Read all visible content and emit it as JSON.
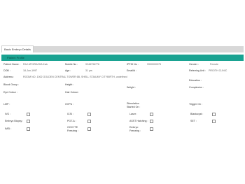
{
  "tab": {
    "label": "Basic Embryo Details"
  },
  "section": {
    "title": "Patient Profile"
  },
  "fields": {
    "patient_name": {
      "label": "Patient Name :",
      "value": "RAJ ATHIRAZHA Ihsk"
    },
    "mobile_no": {
      "label": "Mobile No :",
      "value": "9248736776"
    },
    "ipfid_no": {
      "label": "IPFID No :",
      "value": "9900000075"
    },
    "gender": {
      "label": "Gender :",
      "value": "Female"
    },
    "dob": {
      "label": "DOB :",
      "value": "18-Jun-1997"
    },
    "age": {
      "label": "Age :",
      "value": "31 yrs"
    },
    "email": {
      "label": "EmailId :",
      "value": ""
    },
    "referring_unit": {
      "label": "Referring Unit :",
      "value": "PRIOTH CLINIC"
    },
    "address": {
      "label": "Address :",
      "value": "ROOM NO. 1002 GOLDEN CENTRAL TOWER 6B, SHELL STAIUMY CITYBIRTH, undefined"
    },
    "education": {
      "label": "Education :",
      "value": ""
    },
    "blood_group": {
      "label": "Blood Group :",
      "value": ""
    },
    "height": {
      "label": "Height :",
      "value": ""
    },
    "weight": {
      "label": "Weight :",
      "value": ""
    },
    "complexion": {
      "label": "Complexion :",
      "value": ""
    },
    "eye_colour": {
      "label": "Eye Colour :",
      "value": ""
    },
    "hair_colour": {
      "label": "Hair Colour :",
      "value": ""
    },
    "lmp": {
      "label": "LMP :",
      "value": ""
    },
    "ovpu": {
      "label": "OVPU :",
      "value": ""
    },
    "stimulation_started_on": {
      "label": "Stimulation Started On :",
      "value": ""
    },
    "trigger_on": {
      "label": "Trigger On :",
      "value": ""
    }
  },
  "checkboxes": {
    "ivf": {
      "label": "IVG :"
    },
    "icsi": {
      "label": "ICSI :"
    },
    "laser": {
      "label": "Laser :"
    },
    "blastocyst": {
      "label": "Blastocyst :"
    },
    "embryo_biopsy": {
      "label": "Embryo Biopsy :"
    },
    "pgt_a": {
      "label": "PGT-A :"
    },
    "assist_hatching": {
      "label": "ASST Hatching :"
    },
    "set": {
      "label": "SET :"
    },
    "imsi": {
      "label": "IMSI :"
    },
    "oocyte_freezing": {
      "label": "OOCYTE Freezing :"
    },
    "embryo_freezing": {
      "label": "Embryo Freezing :"
    }
  }
}
